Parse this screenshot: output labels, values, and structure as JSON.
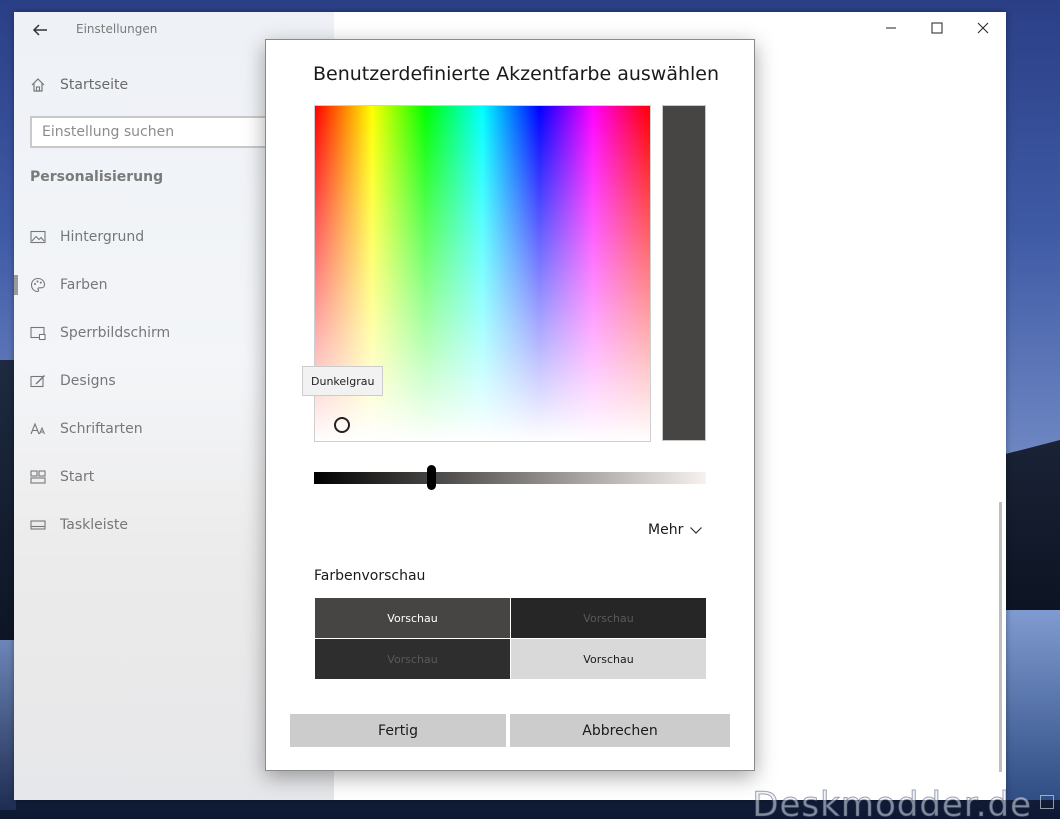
{
  "settings": {
    "app_title": "Einstellungen",
    "home_label": "Startseite",
    "search_placeholder": "Einstellung suchen",
    "section_title": "Personalisierung",
    "nav_items": [
      {
        "label": "Hintergrund",
        "icon": "picture-icon"
      },
      {
        "label": "Farben",
        "icon": "palette-icon",
        "selected": true
      },
      {
        "label": "Sperrbildschirm",
        "icon": "lock-screen-icon"
      },
      {
        "label": "Designs",
        "icon": "brush-icon"
      },
      {
        "label": "Schriftarten",
        "icon": "font-icon"
      },
      {
        "label": "Start",
        "icon": "start-tiles-icon"
      },
      {
        "label": "Taskleiste",
        "icon": "taskbar-icon"
      }
    ]
  },
  "dialog": {
    "title": "Benutzerdefinierte Akzentfarbe auswählen",
    "tooltip": "Dunkelgrau",
    "selected_color": "#474543",
    "more_label": "Mehr",
    "preview_title": "Farbenvorschau",
    "preview_tiles": [
      {
        "label": "Vorschau",
        "background": "#474543",
        "text_color": "#ffffff"
      },
      {
        "label": "Vorschau",
        "background": "#262626",
        "text_color": "#595959"
      },
      {
        "label": "Vorschau",
        "background": "#2e2e2e",
        "text_color": "#595959"
      },
      {
        "label": "Vorschau",
        "background": "#d9d9d9",
        "text_color": "#1a1a1a"
      }
    ],
    "done_label": "Fertig",
    "cancel_label": "Abbrechen"
  },
  "watermark": "Deskmodder.de"
}
